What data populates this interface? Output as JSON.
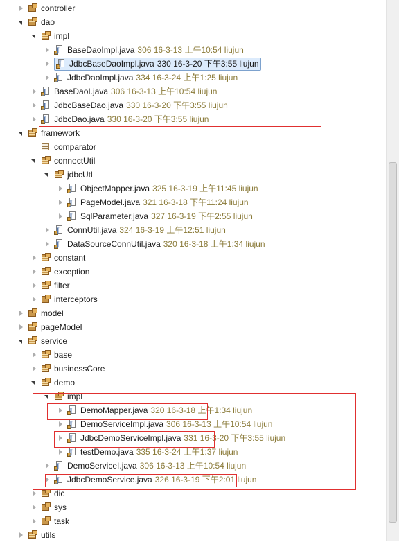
{
  "tree": [
    {
      "name": "controller",
      "kind": "pkg",
      "expanded": false,
      "meta": ""
    },
    {
      "name": "dao",
      "kind": "pkg",
      "expanded": true,
      "meta": ""
    },
    {
      "name": "impl",
      "kind": "pkg",
      "expanded": true,
      "meta": ""
    },
    {
      "name": "BaseDaoImpl.java",
      "kind": "java",
      "expanded": false,
      "meta": "306  16-3-13 上午10:54  liujun"
    },
    {
      "name": "JdbcBaseDaoImpl.java",
      "kind": "java",
      "expanded": false,
      "meta": "330  16-3-20 下午3:55  liujun",
      "selected": true
    },
    {
      "name": "JdbcDaoImpl.java",
      "kind": "java",
      "expanded": false,
      "meta": "334  16-3-24 上午1:25  liujun"
    },
    {
      "name": "BaseDaoI.java",
      "kind": "java",
      "expanded": false,
      "meta": "306  16-3-13 上午10:54  liujun"
    },
    {
      "name": "JdbcBaseDao.java",
      "kind": "java",
      "expanded": false,
      "meta": "330  16-3-20 下午3:55  liujun"
    },
    {
      "name": "JdbcDao.java",
      "kind": "java",
      "expanded": false,
      "meta": "330  16-3-20 下午3:55  liujun"
    },
    {
      "name": "framework",
      "kind": "pkg",
      "expanded": true,
      "meta": ""
    },
    {
      "name": "comparator",
      "kind": "pkg-empty",
      "expanded": null,
      "meta": ""
    },
    {
      "name": "connectUtil",
      "kind": "pkg",
      "expanded": true,
      "meta": ""
    },
    {
      "name": "jdbcUtl",
      "kind": "pkg",
      "expanded": true,
      "meta": ""
    },
    {
      "name": "ObjectMapper.java",
      "kind": "java",
      "expanded": false,
      "meta": "325  16-3-19 上午11:45  liujun"
    },
    {
      "name": "PageModel.java",
      "kind": "java",
      "expanded": false,
      "meta": "321  16-3-18 下午11:24  liujun"
    },
    {
      "name": "SqlParameter.java",
      "kind": "java",
      "expanded": false,
      "meta": "327  16-3-19 下午2:55  liujun"
    },
    {
      "name": "ConnUtil.java",
      "kind": "java",
      "expanded": false,
      "meta": "324  16-3-19 上午12:51  liujun"
    },
    {
      "name": "DataSourceConnUtil.java",
      "kind": "java",
      "expanded": false,
      "meta": "320  16-3-18 上午1:34  liujun"
    },
    {
      "name": "constant",
      "kind": "pkg",
      "expanded": false,
      "meta": ""
    },
    {
      "name": "exception",
      "kind": "pkg",
      "expanded": false,
      "meta": ""
    },
    {
      "name": "filter",
      "kind": "pkg",
      "expanded": false,
      "meta": ""
    },
    {
      "name": "interceptors",
      "kind": "pkg",
      "expanded": false,
      "meta": ""
    },
    {
      "name": "model",
      "kind": "pkg",
      "expanded": false,
      "meta": ""
    },
    {
      "name": "pageModel",
      "kind": "pkg",
      "expanded": false,
      "meta": ""
    },
    {
      "name": "service",
      "kind": "pkg",
      "expanded": true,
      "meta": ""
    },
    {
      "name": "base",
      "kind": "pkg",
      "expanded": false,
      "meta": ""
    },
    {
      "name": "businessCore",
      "kind": "pkg",
      "expanded": false,
      "meta": ""
    },
    {
      "name": "demo",
      "kind": "pkg",
      "expanded": true,
      "meta": ""
    },
    {
      "name": "impl",
      "kind": "pkg",
      "expanded": true,
      "meta": ""
    },
    {
      "name": "DemoMapper.java",
      "kind": "java",
      "expanded": false,
      "meta": "320  16-3-18 上午1:34  liujun"
    },
    {
      "name": "DemoServiceImpl.java",
      "kind": "java",
      "expanded": false,
      "meta": "306  16-3-13 上午10:54  liujun"
    },
    {
      "name": "JdbcDemoServiceImpl.java",
      "kind": "java",
      "expanded": false,
      "meta": "331  16-3-20 下午3:55  liujun"
    },
    {
      "name": "testDemo.java",
      "kind": "java",
      "expanded": false,
      "meta": "335  16-3-24 上午1:37  liujun"
    },
    {
      "name": "DemoServiceI.java",
      "kind": "java",
      "expanded": false,
      "meta": "306  16-3-13 上午10:54  liujun"
    },
    {
      "name": "JdbcDemoService.java",
      "kind": "java",
      "expanded": false,
      "meta": "326  16-3-19 下午2:01  liujun"
    },
    {
      "name": "dic",
      "kind": "pkg",
      "expanded": false,
      "meta": ""
    },
    {
      "name": "sys",
      "kind": "pkg",
      "expanded": false,
      "meta": ""
    },
    {
      "name": "task",
      "kind": "pkg",
      "expanded": false,
      "meta": ""
    },
    {
      "name": "utils",
      "kind": "pkg",
      "expanded": false,
      "meta": ""
    }
  ],
  "colors": {
    "highlight": "#e03030",
    "selection": "#dcebfc"
  }
}
